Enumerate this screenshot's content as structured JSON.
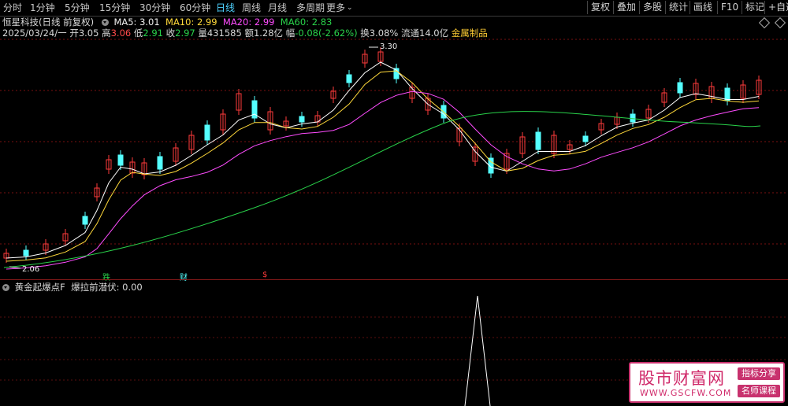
{
  "toolbar": {
    "periods": [
      "分时",
      "1分钟",
      "5分钟",
      "15分钟",
      "30分钟",
      "60分钟",
      "日线",
      "周线",
      "月线",
      "多周期",
      "更多"
    ],
    "active": "日线",
    "buttons": [
      "复权",
      "叠加",
      "多股",
      "统计",
      "画线",
      "F10",
      "标记",
      "+自选"
    ]
  },
  "header": {
    "stock_name": "恒星科技(日线 前复权)",
    "ma5": "MA5: 3.01",
    "ma10": "MA10: 2.99",
    "ma20": "MA20: 2.99",
    "ma60": "MA60: 2.83",
    "date": "2025/03/24/一",
    "open_label": "开",
    "open": "3.05",
    "high_label": "高",
    "high": "3.06",
    "low_label": "低",
    "low": "2.91",
    "close_label": "收",
    "close": "2.97",
    "vol_label": "量",
    "volume": "431585",
    "amt_label": "额",
    "amount": "1.28亿",
    "chg_label": "幅",
    "change": "-0.08(-2.62%)",
    "turn_label": "换",
    "turnover": "3.08%",
    "float_label": "流通",
    "float_cap": "14.0亿",
    "sector": "金属制品"
  },
  "main_chart": {
    "max_label": "3.30",
    "min_label": "2.06",
    "markers": [
      "跌",
      "财",
      "$"
    ],
    "colors": {
      "up": "#ff3b3b",
      "down": "#54ffff",
      "ma5": "#ffffff",
      "ma10": "#ffd93a",
      "ma20": "#ff4cff",
      "ma60": "#29d24a",
      "grid": "#7a1010"
    }
  },
  "indicator": {
    "title": "黄金起爆点F",
    "value_label": "爆拉前潜伏: 0.00"
  },
  "watermark": {
    "site": "股市财富网",
    "url": "WWW.GSCFW.COM",
    "tag1": "指标分享",
    "tag2": "名师课程"
  }
}
